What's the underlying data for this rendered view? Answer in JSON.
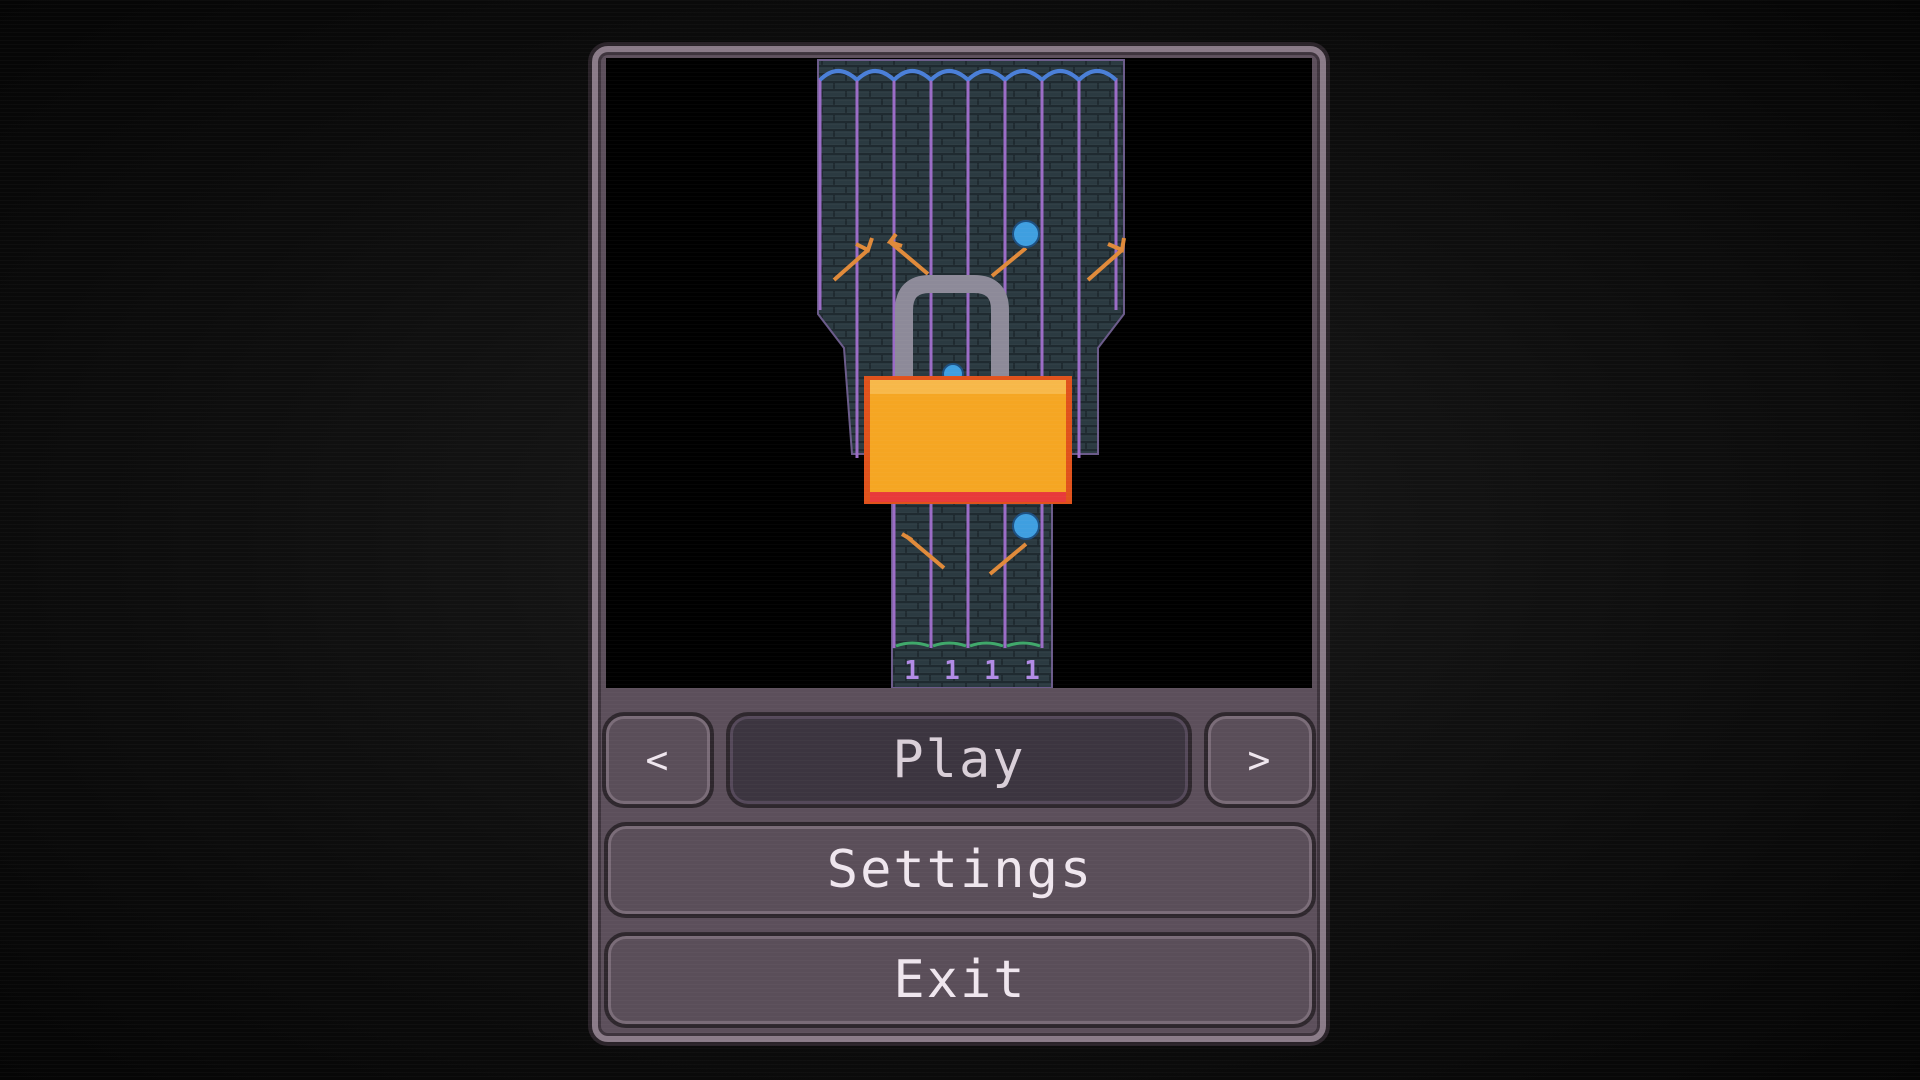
{
  "menu": {
    "prev_label": "<",
    "play_label": "Play",
    "next_label": ">",
    "settings_label": "Settings",
    "exit_label": "Exit",
    "selected": "Play"
  },
  "level_preview": {
    "lane_counters": [
      "1",
      "1",
      "1",
      "1"
    ],
    "locked": true
  },
  "colors": {
    "background": "#0b0b0b",
    "panel": "#5c4f5b",
    "panel_border": "#8a7b88",
    "lock_body": "#f5a623",
    "lock_edge": "#e0521c",
    "ball": "#3f9fe0",
    "lane_line": "#9b6cc6"
  },
  "icons": [
    "padlock-icon",
    "chevron-left-icon",
    "chevron-right-icon"
  ]
}
